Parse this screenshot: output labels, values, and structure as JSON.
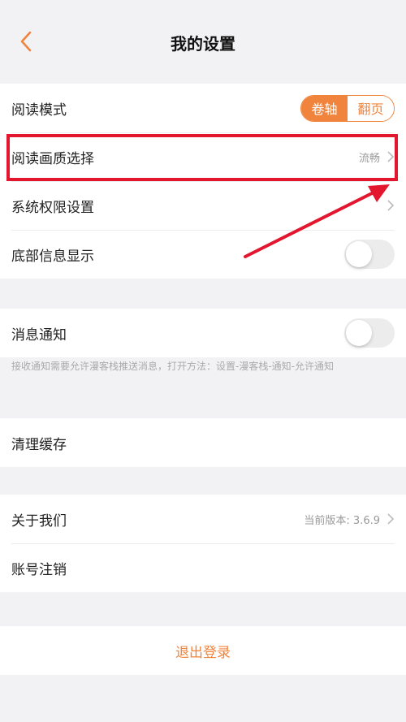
{
  "header": {
    "title": "我的设置"
  },
  "reading": {
    "mode_label": "阅读模式",
    "mode_options": [
      "卷轴",
      "翻页"
    ],
    "mode_selected": "卷轴",
    "quality_label": "阅读画质选择",
    "quality_value": "流畅",
    "permission_label": "系统权限设置",
    "bottom_info_label": "底部信息显示",
    "bottom_info_on": false
  },
  "notification": {
    "label": "消息通知",
    "on": false,
    "note": "接收通知需要允许漫客栈推送消息，打开方法：设置-漫客栈-通知-允许通知"
  },
  "cache": {
    "label": "清理缓存"
  },
  "about": {
    "label": "关于我们",
    "version": "当前版本: 3.6.9",
    "cancel_label": "账号注销"
  },
  "logout": {
    "label": "退出登录"
  },
  "colors": {
    "accent": "#f0843c",
    "highlight": "#e3162d",
    "background": "#f2f2f4"
  }
}
